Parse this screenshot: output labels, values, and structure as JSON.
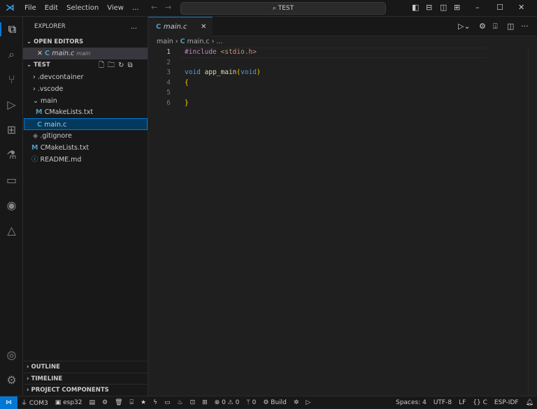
{
  "titlebar": {
    "menus": [
      "File",
      "Edit",
      "Selection",
      "View",
      "..."
    ],
    "search": "TEST"
  },
  "sidebar": {
    "title": "EXPLORER",
    "more": "...",
    "open_editors": "OPEN EDITORS",
    "open_file": "main.c",
    "open_file_dir": "main",
    "workspace": "TEST",
    "tree": [
      {
        "label": ".devcontainer",
        "type": "folder"
      },
      {
        "label": ".vscode",
        "type": "folder"
      },
      {
        "label": "main",
        "type": "folder-open"
      },
      {
        "label": "CMakeLists.txt",
        "type": "cmake"
      },
      {
        "label": "main.c",
        "type": "c"
      },
      {
        "label": ".gitignore",
        "type": "git"
      },
      {
        "label": "CMakeLists.txt",
        "type": "cmake"
      },
      {
        "label": "README.md",
        "type": "info"
      }
    ],
    "sections": [
      "OUTLINE",
      "TIMELINE",
      "PROJECT COMPONENTS"
    ]
  },
  "editor": {
    "tab": "main.c",
    "breadcrumb": [
      "main",
      "main.c",
      "..."
    ],
    "lines": [
      "1",
      "2",
      "3",
      "4",
      "5",
      "6"
    ]
  },
  "status": {
    "com": "COM3",
    "target": "esp32",
    "errors": "0",
    "warnings": "0",
    "ports": "0",
    "build": "Build",
    "spaces": "Spaces: 4",
    "encoding": "UTF-8",
    "eol": "LF",
    "lang": "C",
    "idf": "ESP-IDF"
  },
  "colors": {
    "accent": "#0078d4",
    "keyword": "#569cd6",
    "preproc": "#c586c0",
    "string": "#ce9178",
    "func": "#dcdcaa",
    "brace": "#ffd700"
  }
}
